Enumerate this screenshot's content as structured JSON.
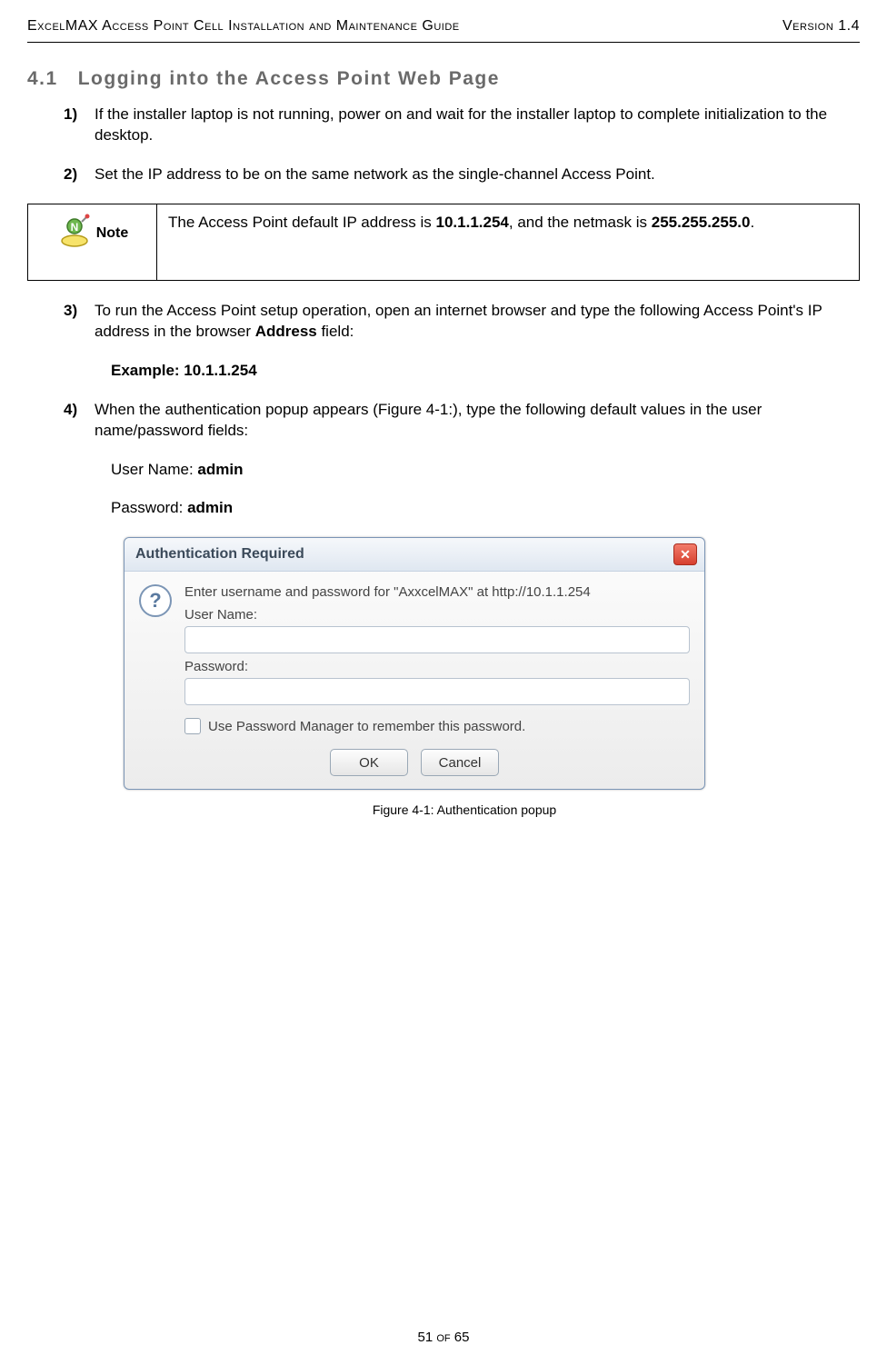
{
  "header": {
    "left": "ExcelMAX Access Point Cell Installation and Maintenance Guide",
    "right": "Version 1.4"
  },
  "section": {
    "number": "4.1",
    "title": "Logging into the Access Point Web Page"
  },
  "steps": {
    "s1": {
      "num": "1)",
      "text": "If the installer laptop is not running, power on and wait for the installer laptop to complete initialization to the desktop."
    },
    "s2": {
      "num": "2)",
      "text": "Set the IP address to be on the same network as the single-channel Access Point."
    },
    "s3": {
      "num": "3)",
      "text_a": "To run the Access Point setup operation, open an internet browser and type the following Access Point's IP address in the browser ",
      "text_b_bold": "Address",
      "text_c": " field:",
      "example": "Example: 10.1.1.254"
    },
    "s4": {
      "num": "4)",
      "text": "When the authentication popup appears (Figure 4-1:), type the following default values in the user name/password fields:",
      "username_label": "User Name: ",
      "username_value": "admin",
      "password_label": "Password: ",
      "password_value": "admin"
    }
  },
  "note": {
    "label": "Note",
    "text_a": "The Access Point default IP address is ",
    "ip": "10.1.1.254",
    "text_b": ", and the netmask is ",
    "netmask": "255.255.255.0",
    "text_c": "."
  },
  "dialog": {
    "title": "Authentication Required",
    "close_glyph": "✕",
    "icon_glyph": "?",
    "prompt": "Enter username and password for \"AxxcelMAX\" at http://10.1.1.254",
    "user_label": "User Name:",
    "user_value": "",
    "pass_label": "Password:",
    "pass_value": "",
    "remember": "Use Password Manager to remember this password.",
    "ok": "OK",
    "cancel": "Cancel"
  },
  "figure_caption": "Figure 4-1: Authentication popup",
  "footer": "51 of 65"
}
